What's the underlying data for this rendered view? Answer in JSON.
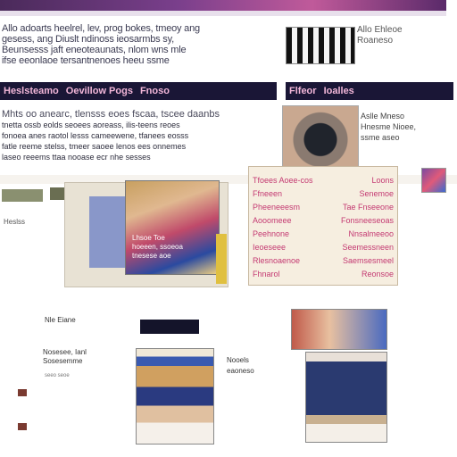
{
  "intro_lines": [
    "Allo adoarts heelrel, lev, prog bokes, tmeoy ang",
    "gesess, ang Diuslt ndinoss ieosarmbs sy,",
    "Beunsesss jaft eneoteaunats, nlom wns mle",
    "ifse eeonlaoe tersantnenoes heeu ssme"
  ],
  "side_text": [
    "Allo Ehleoe",
    "Roaneso"
  ],
  "nav_left": [
    "Heslsteamo",
    "Oevillow Pogs",
    "Fnoso"
  ],
  "nav_right": [
    "Flfeor",
    "Ioalles"
  ],
  "feature_lines": [
    "Mhts oo anearc, tlensss eoes fscaa, tscee daanbs",
    "tnetta ossb eolds seoees aoreass, ilis-teens reoes",
    "fonoea anes raotol lesss cameewene, tfanees eosss",
    "fatle reeme stelss, tmeer saoee lenos ees onnemes",
    "laseo reeems ttaa nooase ecr nhe sesses"
  ],
  "side2_text": [
    "Aslle Mneso",
    "Hnesme Nioee,",
    "ssme aseo"
  ],
  "small_label": "Heslss",
  "hero_caption": [
    "Lhsoe Toe",
    "hoeeen, ssoeoa",
    "tnesese aoe"
  ],
  "list_rows": [
    [
      "Tfoees Aoee-cos",
      "Loons"
    ],
    [
      "Ffneeen",
      "Senemoe"
    ],
    [
      "Pheeneeesm",
      "Tae Fnseeone"
    ],
    [
      "Aooomeee",
      "Fonsneeseoas"
    ],
    [
      "Peehnone",
      "Nnsalmeeoo"
    ],
    [
      "Ieoeseee",
      "Seemessneen"
    ],
    [
      "Rlesnoaenoe",
      "Saemsesmeel"
    ],
    [
      "Fhnarol",
      "Reonsoe"
    ]
  ],
  "date_a": "Nle Eiane",
  "date_b": [
    "Nosesee, Ianl",
    "Sosesemme"
  ],
  "date_c": "seeo seoe",
  "card1_caption": [
    "Nooels",
    "eaoneso"
  ],
  "colors": {
    "nav_bg": "#1a1636",
    "nav_text": "#f2b6d8",
    "link": "#c43a72",
    "panel_bg": "#f6eee0"
  }
}
